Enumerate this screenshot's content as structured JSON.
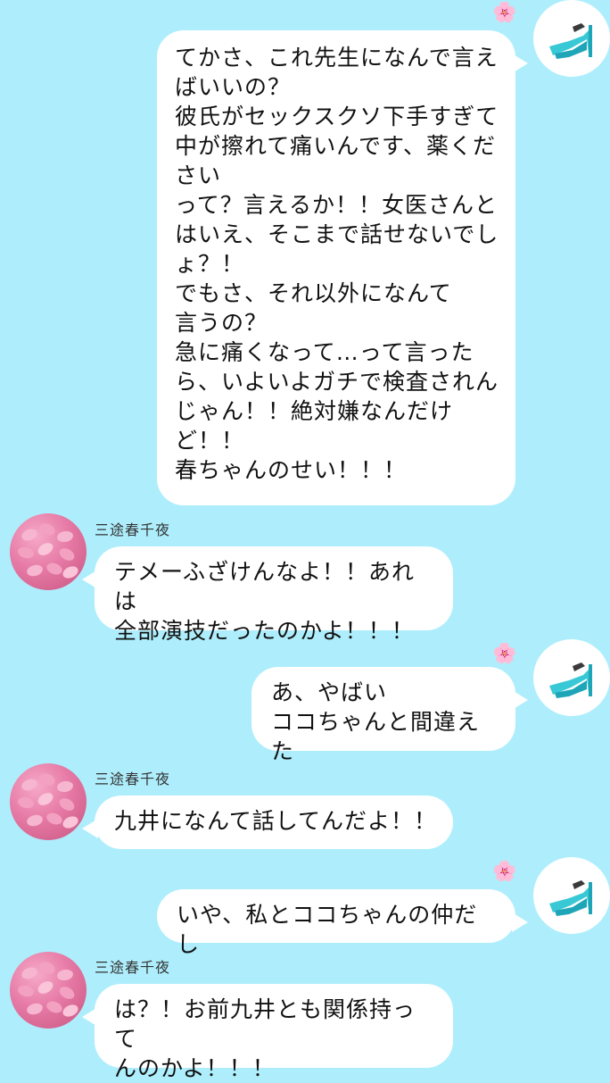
{
  "chat": {
    "sender_name": "三途春千夜",
    "self_avatar_icon": "high-heel-shoe-icon",
    "other_avatar_icon": "pink-pills-icon",
    "self_reaction_icon": "cherry-blossom-icon",
    "self_reaction_glyph": "🌸",
    "messages": [
      {
        "from": "self",
        "text": "てかさ、これ先生になんで言えばいいの？\n彼氏がセックスクソ下手すぎて中が擦れて痛いんです、薬ください\nって？言えるか！！女医さんとはいえ、そこまで話せないでしょ？！\nでもさ、それ以外になんて\n言うの？\n急に痛くなって…って言ったら、いよいよガチで検査されんじゃん！！絶対嫌なんだけど！！\n春ちゃんのせい！！！"
      },
      {
        "from": "other",
        "text": "テメーふざけんなよ！！あれは\n全部演技だったのかよ！！！"
      },
      {
        "from": "self",
        "text": "あ、やばい\nココちゃんと間違えた"
      },
      {
        "from": "other",
        "text": "九井になんて話してんだよ！！"
      },
      {
        "from": "self",
        "text": "いや、私とココちゃんの仲だし"
      },
      {
        "from": "other",
        "text": "は？！お前九井とも関係持って\nんのかよ！！！"
      }
    ]
  },
  "colors": {
    "background": "#aeeefc",
    "bubble": "#ffffff",
    "text": "#111111",
    "shoe": "#39c8d6",
    "pills": "#e67aa6"
  }
}
